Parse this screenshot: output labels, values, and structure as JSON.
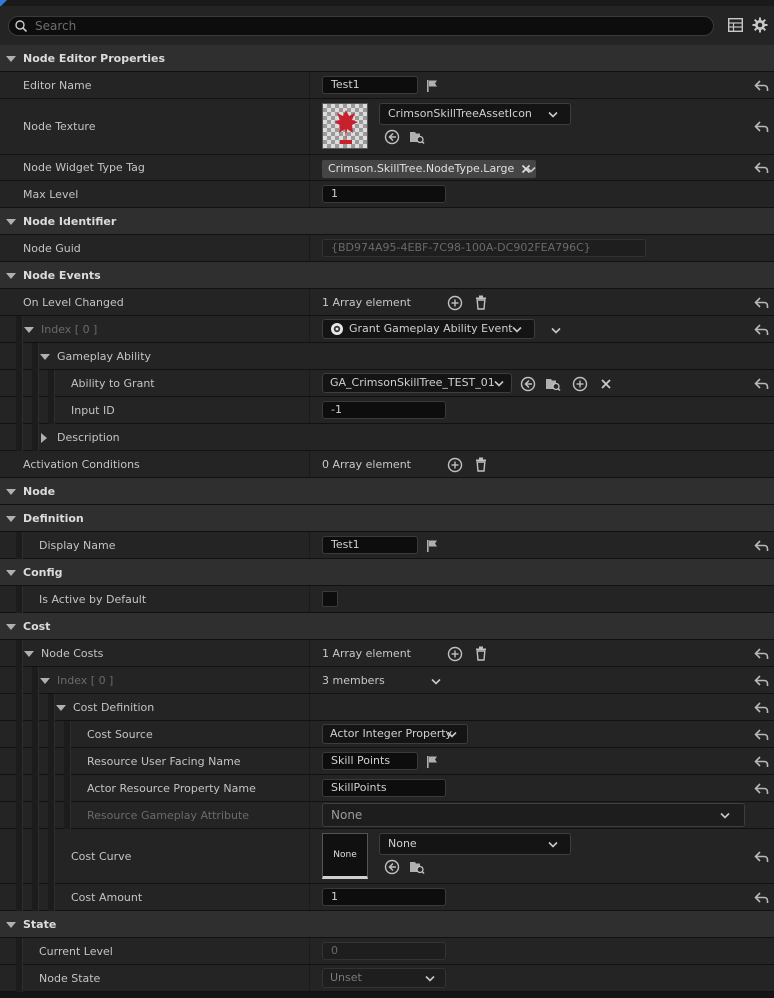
{
  "search": {
    "placeholder": "Search",
    "icon": "search-icon"
  },
  "toolbar": {
    "table_icon": "table-view-icon",
    "settings_icon": "gear-icon"
  },
  "rows": [
    {
      "kind": "cat",
      "h": 27,
      "label": "Node Editor Properties"
    },
    {
      "label": "Editor Name",
      "h": 27,
      "w": "text",
      "value": "Test1",
      "flag": true
    },
    {
      "label": "Node Texture",
      "h": 56,
      "w": "asset",
      "thumb": "checker",
      "combo": "CrimsonSkillTreeAssetIcon"
    },
    {
      "label": "Node Widget Type Tag",
      "h": 26,
      "w": "tag",
      "value": "Crimson.SkillTree.NodeType.Large"
    },
    {
      "label": "Max Level",
      "h": 27,
      "w": "text",
      "value": "1",
      "textw": 124,
      "noreset": true
    },
    {
      "kind": "cat",
      "h": 27,
      "label": "Node Identifier"
    },
    {
      "label": "Node Guid",
      "h": 27,
      "w": "text",
      "value": "{BD974A95-4EBF-7C98-100A-DC902FEA796C}",
      "textw": 324,
      "ro": true,
      "noreset": true
    },
    {
      "kind": "cat",
      "h": 27,
      "label": "Node Events"
    },
    {
      "label": "On Level Changed",
      "h": 27,
      "w": "array",
      "value": "1 Array element"
    },
    {
      "label": "Index [ 0 ]",
      "h": 27,
      "level": 1,
      "expander": "down",
      "dim": true,
      "w": "event",
      "value": "Grant Gameplay Ability Event"
    },
    {
      "label": "Gameplay Ability",
      "h": 27,
      "level": 2,
      "expander": "down",
      "w": "none",
      "noreset": true,
      "wide": true
    },
    {
      "label": "Ability to Grant",
      "h": 27,
      "level": 3,
      "w": "ability",
      "value": "GA_CrimsonSkillTree_TEST_01"
    },
    {
      "label": "Input ID",
      "h": 27,
      "level": 3,
      "w": "text",
      "value": "-1",
      "textw": 124,
      "noreset": true
    },
    {
      "label": "Description",
      "h": 27,
      "level": 2,
      "expander": "right",
      "w": "none",
      "noreset": true,
      "wide": true
    },
    {
      "label": "Activation Conditions",
      "h": 27,
      "w": "array",
      "value": "0 Array element",
      "noreset": true
    },
    {
      "kind": "cat",
      "h": 27,
      "label": "Node"
    },
    {
      "kind": "cat",
      "h": 27,
      "label": "Definition",
      "sub": true
    },
    {
      "label": "Display Name",
      "h": 27,
      "level": 1,
      "w": "text",
      "value": "Test1",
      "flag": true
    },
    {
      "kind": "cat",
      "h": 27,
      "label": "Config",
      "sub": true
    },
    {
      "label": "Is Active by Default",
      "h": 27,
      "level": 1,
      "w": "check",
      "noreset": true
    },
    {
      "kind": "cat",
      "h": 27,
      "label": "Cost",
      "sub": true
    },
    {
      "label": "Node Costs",
      "h": 27,
      "level": 1,
      "expander": "down",
      "w": "array",
      "value": "1 Array element"
    },
    {
      "label": "Index [ 0 ]",
      "h": 27,
      "level": 2,
      "expander": "down",
      "dim": true,
      "w": "members",
      "value": "3 members"
    },
    {
      "label": "Cost Definition",
      "h": 27,
      "level": 3,
      "expander": "down",
      "w": "none"
    },
    {
      "label": "Cost Source",
      "h": 27,
      "level": 4,
      "w": "combo",
      "value": "Actor Integer Property"
    },
    {
      "label": "Resource User Facing Name",
      "h": 27,
      "level": 4,
      "w": "text",
      "value": "Skill Points",
      "flag": true,
      "textw": 96
    },
    {
      "label": "Actor Resource Property Name",
      "h": 27,
      "level": 4,
      "w": "text",
      "value": "SkillPoints",
      "textw": 124
    },
    {
      "label": "Resource Gameplay Attribute",
      "h": 27,
      "level": 4,
      "dim": true,
      "w": "bigcombo",
      "value": "None",
      "noreset": true
    },
    {
      "label": "Cost Curve",
      "h": 55,
      "level": 3,
      "w": "asset",
      "thumb": "dark",
      "thumbtext": "None",
      "combo": "None"
    },
    {
      "label": "Cost Amount",
      "h": 27,
      "level": 3,
      "w": "text",
      "value": "1",
      "textw": 124
    },
    {
      "kind": "cat",
      "h": 27,
      "label": "State",
      "sub": true
    },
    {
      "label": "Current Level",
      "h": 27,
      "level": 1,
      "w": "text",
      "value": "0",
      "textw": 124,
      "ro": true,
      "noreset": true
    },
    {
      "label": "Node State",
      "h": 27,
      "level": 1,
      "w": "rocombo",
      "value": "Unset",
      "noreset": true
    }
  ]
}
